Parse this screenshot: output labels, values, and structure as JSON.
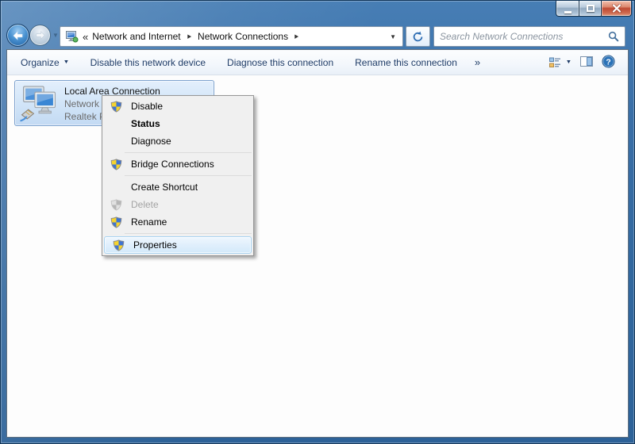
{
  "navbar": {
    "breadcrumb": {
      "overflow_chevron": "«",
      "separator": "▶",
      "items": [
        {
          "label": "Network and Internet"
        },
        {
          "label": "Network Connections"
        }
      ],
      "dropdown_glyph": "▼"
    },
    "nav_dropdown_glyph": "▼",
    "search": {
      "placeholder": "Search Network Connections"
    }
  },
  "toolbar": {
    "organize": {
      "label": "Organize",
      "dropdown_glyph": "▼"
    },
    "commands": [
      {
        "label": "Disable this network device"
      },
      {
        "label": "Diagnose this connection"
      },
      {
        "label": "Rename this connection"
      }
    ],
    "overflow_chevron": "»",
    "views_dropdown_glyph": "▼"
  },
  "content": {
    "connection": {
      "name": "Local Area Connection",
      "network": "Network",
      "device": "Realtek P"
    }
  },
  "context_menu": {
    "items": [
      {
        "label": "Disable",
        "shield": true,
        "enabled": true
      },
      {
        "label": "Status",
        "shield": false,
        "enabled": true,
        "bold": true
      },
      {
        "label": "Diagnose",
        "shield": false,
        "enabled": true
      },
      {
        "label": "Bridge Connections",
        "shield": true,
        "enabled": true
      },
      {
        "label": "Create Shortcut",
        "shield": false,
        "enabled": true
      },
      {
        "label": "Delete",
        "shield": true,
        "enabled": false
      },
      {
        "label": "Rename",
        "shield": true,
        "enabled": true
      },
      {
        "label": "Properties",
        "shield": true,
        "enabled": true,
        "highlighted": true
      }
    ]
  },
  "icons": {
    "back": "left-arrow-circle",
    "forward": "right-arrow-circle",
    "address": "network-connections-folder",
    "refresh": "circular-arrows",
    "search": "magnifier",
    "views": "tile-list",
    "preview_pane": "split-panel",
    "help": "question-circle",
    "menu_shield": "uac-shield",
    "tile": "dual-monitors-with-ethernet-plug"
  },
  "colors": {
    "titlebar_blue": "#32689f",
    "toolbar_text": "#1f3c67",
    "selection_border": "#7da2ce",
    "selection_fill": "#d2e5f8",
    "menu_bg": "#f0f0f0",
    "menu_border": "#979797",
    "menu_highlight_border": "#a9d3f1",
    "close_button_red": "#c04b33",
    "disabled_text": "#a3a3a3"
  }
}
